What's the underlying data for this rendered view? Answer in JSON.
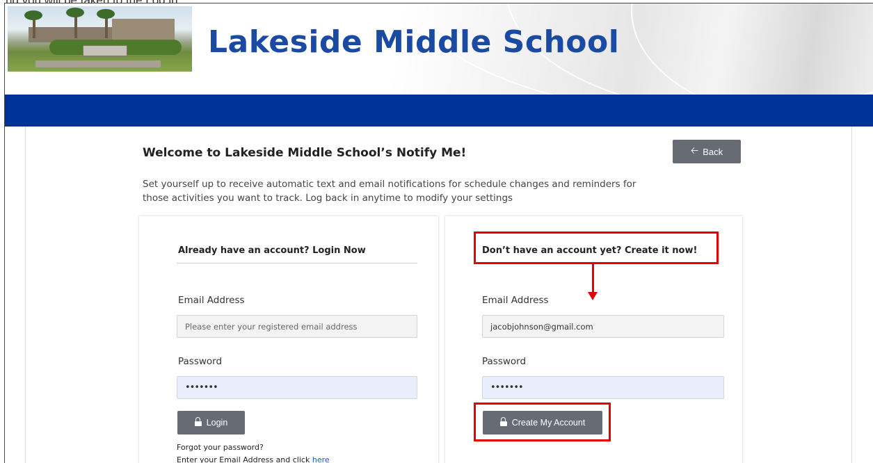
{
  "cropped_text": "nd you will be taken to the Log in",
  "header": {
    "school_name": "Lakeside Middle School"
  },
  "page": {
    "welcome_title": "Welcome to Lakeside Middle School’s Notify Me!",
    "back_label": "Back",
    "intro_text": "Set yourself up to receive automatic text and email notifications for schedule changes and reminders for those activities you want to track. Log back in anytime to modify your settings"
  },
  "login_panel": {
    "title": "Already have an account? Login Now",
    "email_label": "Email Address",
    "email_placeholder": "Please enter your registered email address",
    "password_label": "Password",
    "password_value": "•••••••",
    "login_label": "Login",
    "forgot_title": "Forgot your password?",
    "forgot_text": "Enter your Email Address and click",
    "forgot_link": "here"
  },
  "create_panel": {
    "title": "Don’t have an account yet? Create it now!",
    "email_label": "Email Address",
    "email_value": "jacobjohnson@gmail.com",
    "password_label": "Password",
    "password_value": "•••••••",
    "create_label": "Create My Account"
  },
  "annotation_color": "#e60000",
  "icons": [
    "back-arrow-icon",
    "lock-icon"
  ]
}
